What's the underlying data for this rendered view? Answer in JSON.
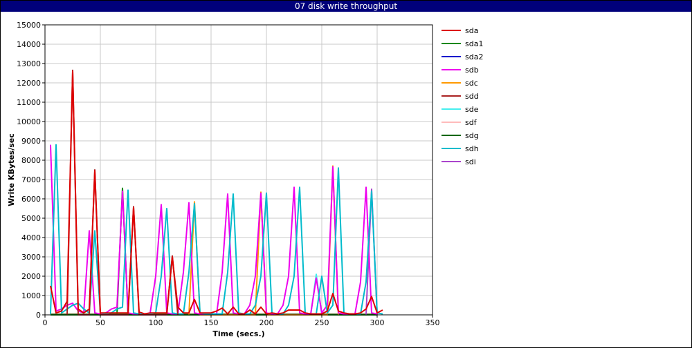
{
  "window": {
    "title": "07 disk write throughput"
  },
  "chart_data": {
    "type": "line",
    "title": "07 disk write throughput",
    "xlabel": "Time (secs.)",
    "ylabel": "Write KBytes/sec",
    "xlim": [
      0,
      350
    ],
    "ylim": [
      0,
      15000
    ],
    "xticks": [
      0,
      50,
      100,
      150,
      200,
      250,
      300,
      350
    ],
    "yticks": [
      0,
      1000,
      2000,
      3000,
      4000,
      5000,
      6000,
      7000,
      8000,
      9000,
      10000,
      11000,
      12000,
      13000,
      14000,
      15000
    ],
    "grid": true,
    "legend_position": "right",
    "series": [
      {
        "name": "sda",
        "color": "#dd0000",
        "x": [
          5,
          10,
          15,
          20,
          25,
          30,
          35,
          40,
          45,
          50,
          55,
          60,
          65,
          70,
          75,
          80,
          85,
          90,
          95,
          100,
          105,
          110,
          115,
          120,
          125,
          130,
          135,
          140,
          145,
          150,
          155,
          160,
          165,
          170,
          175,
          180,
          185,
          190,
          195,
          200,
          205,
          210,
          215,
          220,
          225,
          230,
          235,
          240,
          245,
          250,
          255,
          260,
          265,
          270,
          275,
          280,
          285,
          290,
          295,
          300,
          305
        ],
        "y": [
          1500,
          100,
          200,
          700,
          12600,
          300,
          100,
          300,
          7450,
          100,
          100,
          100,
          100,
          100,
          100,
          5550,
          150,
          50,
          100,
          100,
          100,
          100,
          3000,
          400,
          100,
          100,
          800,
          100,
          100,
          100,
          200,
          350,
          50,
          400,
          50,
          50,
          250,
          50,
          400,
          50,
          100,
          50,
          100,
          250,
          250,
          250,
          100,
          50,
          50,
          50,
          200,
          1100,
          200,
          100,
          50,
          50,
          100,
          300,
          950,
          100,
          250
        ]
      },
      {
        "name": "sda1",
        "color": "#008800",
        "x": [
          5,
          65,
          70,
          75,
          300
        ],
        "y": [
          0,
          0,
          6550,
          0,
          0
        ]
      },
      {
        "name": "sda2",
        "color": "#0000cc",
        "x": [
          5,
          300
        ],
        "y": [
          0,
          0
        ]
      },
      {
        "name": "sdb",
        "color": "#ee00ee",
        "x": [
          5,
          10,
          15,
          20,
          25,
          30,
          35,
          40,
          45,
          50,
          55,
          60,
          65,
          70,
          75,
          80,
          85,
          90,
          95,
          100,
          105,
          110,
          115,
          120,
          125,
          130,
          135,
          140,
          145,
          150,
          155,
          160,
          165,
          170,
          175,
          180,
          185,
          190,
          195,
          200,
          205,
          210,
          215,
          220,
          225,
          230,
          235,
          240,
          245,
          250,
          255,
          260,
          265,
          270,
          275,
          280,
          285,
          290,
          295,
          300
        ],
        "y": [
          8800,
          200,
          300,
          500,
          600,
          200,
          100,
          4350,
          100,
          50,
          100,
          300,
          400,
          6400,
          100,
          50,
          50,
          50,
          100,
          2000,
          5700,
          100,
          50,
          50,
          2200,
          5800,
          100,
          50,
          50,
          50,
          50,
          2200,
          6250,
          100,
          50,
          50,
          500,
          2000,
          6300,
          100,
          50,
          50,
          500,
          2000,
          6600,
          100,
          50,
          50,
          1900,
          100,
          500,
          7650,
          100,
          50,
          50,
          50,
          1700,
          6600,
          100,
          50
        ]
      },
      {
        "name": "sdc",
        "color": "#ff9900",
        "x": [
          130,
          135,
          140,
          190,
          195,
          200,
          255,
          260,
          265
        ],
        "y": [
          0,
          5850,
          0,
          0,
          6350,
          0,
          0,
          7700,
          0
        ]
      },
      {
        "name": "sdd",
        "color": "#aa2222",
        "x": [
          20,
          25,
          30,
          40,
          45,
          50,
          75,
          80,
          85,
          110,
          115,
          120
        ],
        "y": [
          0,
          12650,
          0,
          0,
          7500,
          0,
          0,
          5600,
          0,
          0,
          3050,
          0
        ]
      },
      {
        "name": "sde",
        "color": "#44eeee",
        "x": [
          240,
          245,
          250,
          255
        ],
        "y": [
          0,
          2100,
          0,
          0
        ]
      },
      {
        "name": "sdf",
        "color": "#ffbbbb",
        "x": [
          5,
          300
        ],
        "y": [
          50,
          50
        ]
      },
      {
        "name": "sdg",
        "color": "#006600",
        "x": [
          5,
          300
        ],
        "y": [
          20,
          20
        ]
      },
      {
        "name": "sdh",
        "color": "#00bbcc",
        "x": [
          5,
          10,
          15,
          20,
          25,
          30,
          35,
          40,
          45,
          50,
          55,
          60,
          65,
          70,
          75,
          80,
          85,
          90,
          95,
          100,
          105,
          110,
          115,
          120,
          125,
          130,
          135,
          140,
          145,
          150,
          155,
          160,
          165,
          170,
          175,
          180,
          185,
          190,
          195,
          200,
          205,
          210,
          215,
          220,
          225,
          230,
          235,
          240,
          245,
          250,
          255,
          260,
          265,
          270,
          275,
          280,
          285,
          290,
          295,
          300,
          305
        ],
        "y": [
          50,
          8800,
          100,
          300,
          500,
          600,
          300,
          100,
          4350,
          100,
          50,
          100,
          300,
          400,
          6450,
          100,
          50,
          50,
          50,
          100,
          2000,
          5500,
          100,
          50,
          50,
          2200,
          5750,
          100,
          50,
          50,
          50,
          50,
          2200,
          6250,
          100,
          50,
          50,
          500,
          2000,
          6300,
          100,
          50,
          50,
          500,
          2000,
          6600,
          100,
          50,
          50,
          2000,
          100,
          500,
          7600,
          100,
          50,
          50,
          50,
          1700,
          6400,
          100,
          50
        ]
      },
      {
        "name": "sdi",
        "color": "#aa44cc",
        "x": [
          290,
          295,
          300
        ],
        "y": [
          0,
          6500,
          0
        ]
      }
    ]
  }
}
